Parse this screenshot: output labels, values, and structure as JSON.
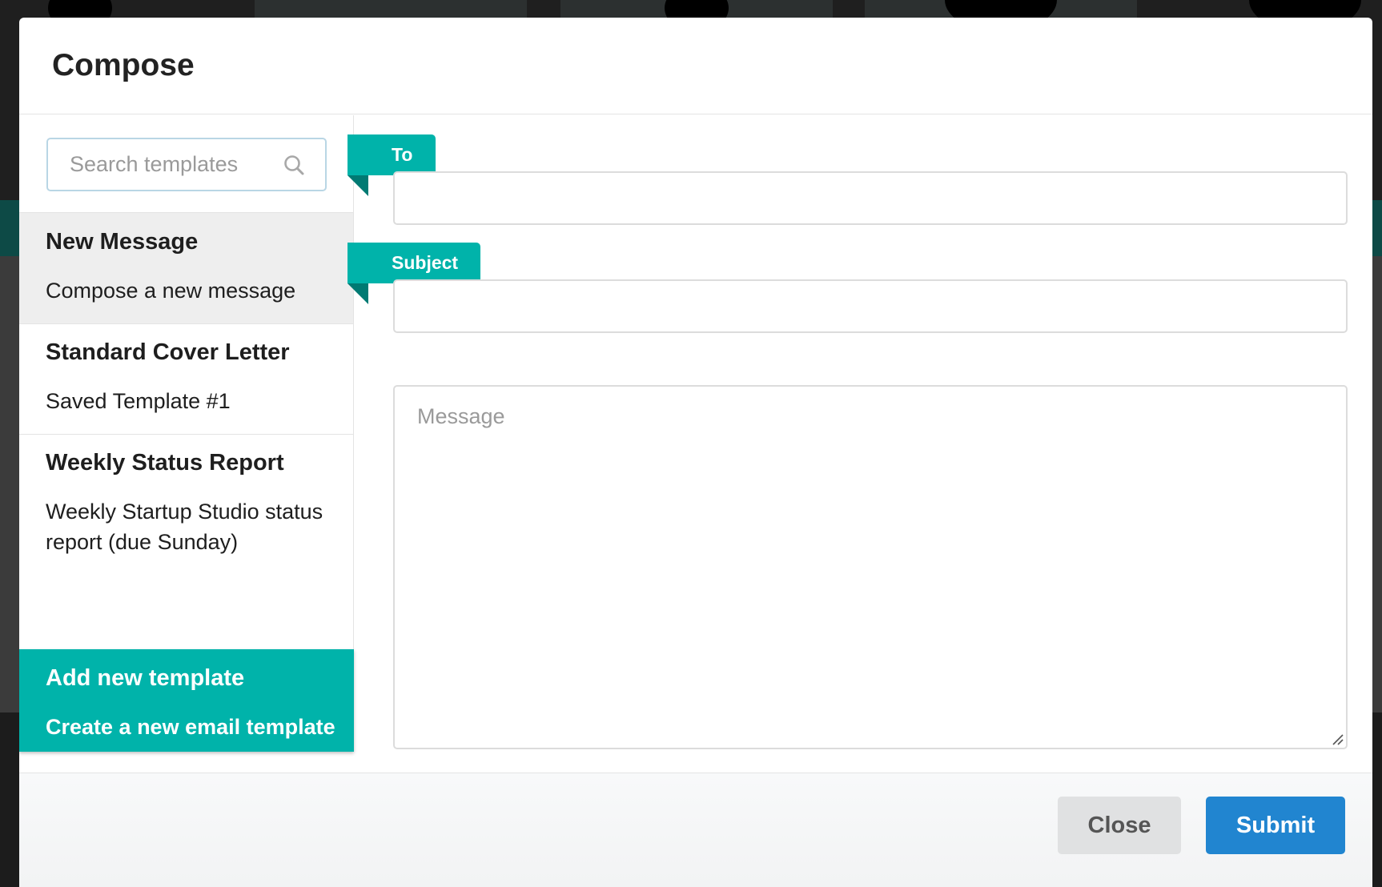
{
  "modal": {
    "title": "Compose"
  },
  "sidebar": {
    "search_placeholder": "Search templates",
    "templates": [
      {
        "title": "New Message",
        "description": "Compose a new message",
        "active": true
      },
      {
        "title": "Standard Cover Letter",
        "description": "Saved Template #1",
        "active": false
      },
      {
        "title": "Weekly Status Report",
        "description": "Weekly Startup Studio status report (due Sunday)",
        "active": false
      }
    ],
    "add_template": {
      "title": "Add new template",
      "description": "Create a new email template"
    }
  },
  "form": {
    "to_label": "To",
    "to_value": "",
    "subject_label": "Subject",
    "subject_value": "",
    "message_placeholder": "Message",
    "message_value": ""
  },
  "footer": {
    "close_label": "Close",
    "submit_label": "Submit"
  },
  "colors": {
    "accent_teal": "#00b3aa",
    "submit_blue": "#2185d0"
  }
}
